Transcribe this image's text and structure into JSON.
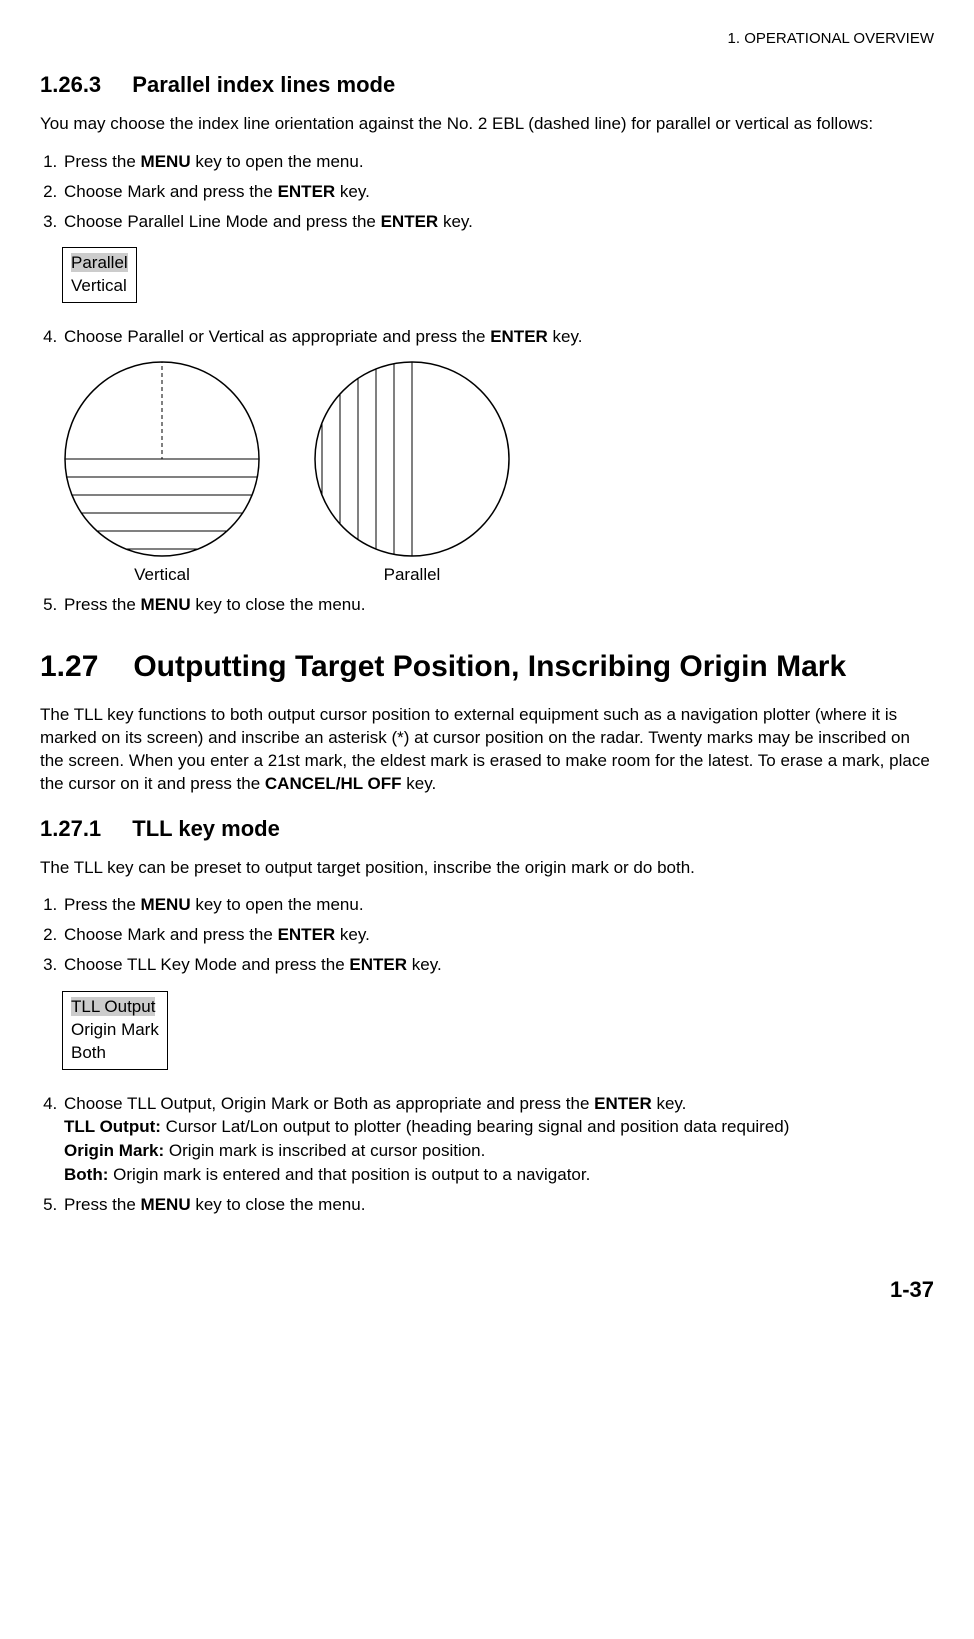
{
  "chapterHeader": "1. OPERATIONAL OVERVIEW",
  "s1263": {
    "num": "1.26.3",
    "title": "Parallel index lines mode",
    "intro": "You may choose the index line orientation against the No. 2 EBL (dashed line) for parallel or vertical as follows:",
    "step1a": "Press the ",
    "step1b": "MENU",
    "step1c": " key to open the menu.",
    "step2a": "Choose Mark and press the ",
    "step2b": "ENTER",
    "step2c": " key.",
    "step3a": "Choose Parallel Line Mode and press the ",
    "step3b": "ENTER",
    "step3c": " key.",
    "opt1": "Parallel",
    "opt2": "Vertical",
    "step4a": "Choose Parallel or Vertical as appropriate and press the ",
    "step4b": "ENTER",
    "step4c": " key.",
    "labelVertical": "Vertical",
    "labelParallel": "Parallel",
    "step5a": "Press the ",
    "step5b": "MENU",
    "step5c": " key to close the menu."
  },
  "s127": {
    "num": "1.27",
    "title": "Outputting Target Position, Inscribing Origin Mark",
    "para1a": "The TLL key functions to both output cursor position to external equipment such as a navigation plotter (where it is marked on its screen) and inscribe an asterisk (*) at cursor position on the radar. Twenty marks may be inscribed on the screen. When you enter a 21st mark, the eldest mark is erased to make room for the latest. To erase a mark, place the cursor on it and press the ",
    "para1b": "CANCEL/HL OFF",
    "para1c": " key."
  },
  "s1271": {
    "num": "1.27.1",
    "title": "TLL key mode",
    "intro": "The TLL key can be preset to output target position, inscribe the origin mark or do both.",
    "step1a": "Press the ",
    "step1b": "MENU",
    "step1c": " key to open the menu.",
    "step2a": "Choose Mark and press the ",
    "step2b": "ENTER",
    "step2c": " key.",
    "step3a": "Choose TLL Key Mode and press the ",
    "step3b": "ENTER",
    "step3c": " key.",
    "opt1": "TLL Output",
    "opt2": "Origin Mark",
    "opt3": "Both",
    "step4a": "Choose TLL Output, Origin Mark or Both as appropriate and press the ",
    "step4b": "ENTER",
    "step4c": " key.",
    "def1a": "TLL Output:",
    "def1b": " Cursor Lat/Lon output to plotter (heading bearing signal and position data required)",
    "def2a": "Origin Mark:",
    "def2b": " Origin mark is inscribed at cursor position.",
    "def3a": "Both:",
    "def3b": " Origin mark is entered and that position is output to a navigator.",
    "step5a": "Press the ",
    "step5b": "MENU",
    "step5c": " key to close the menu."
  },
  "pageNum": "1-37"
}
